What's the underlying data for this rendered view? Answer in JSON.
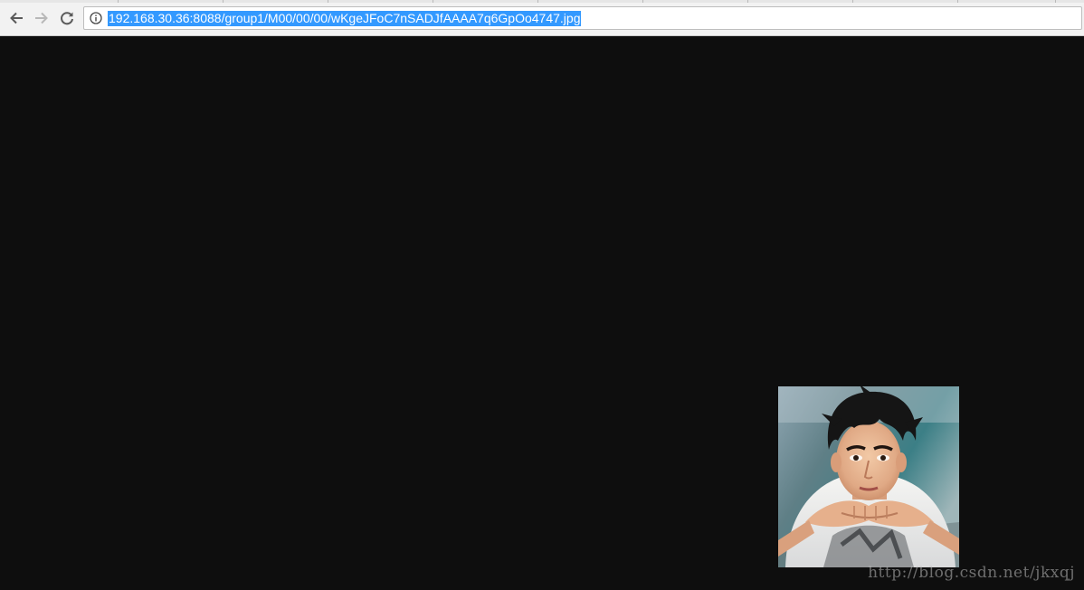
{
  "browser": {
    "address_bar": {
      "url": "192.168.30.36:8088/group1/M00/00/00/wKgeJFoC7nSADJfAAAA7q6GpOo4747.jpg",
      "selected": true,
      "selection_color": "#3399ff"
    },
    "icons": {
      "back": "arrow-left-icon",
      "forward": "arrow-right-icon",
      "reload": "reload-icon",
      "site_info": "info-icon"
    }
  },
  "page": {
    "background_color": "#0e0e0e",
    "image": {
      "subject": "portrait photo of a young man with dark spiky hair resting chin on clasped hands"
    },
    "watermark": {
      "text": "http://blog.csdn.net/jkxqj"
    }
  }
}
